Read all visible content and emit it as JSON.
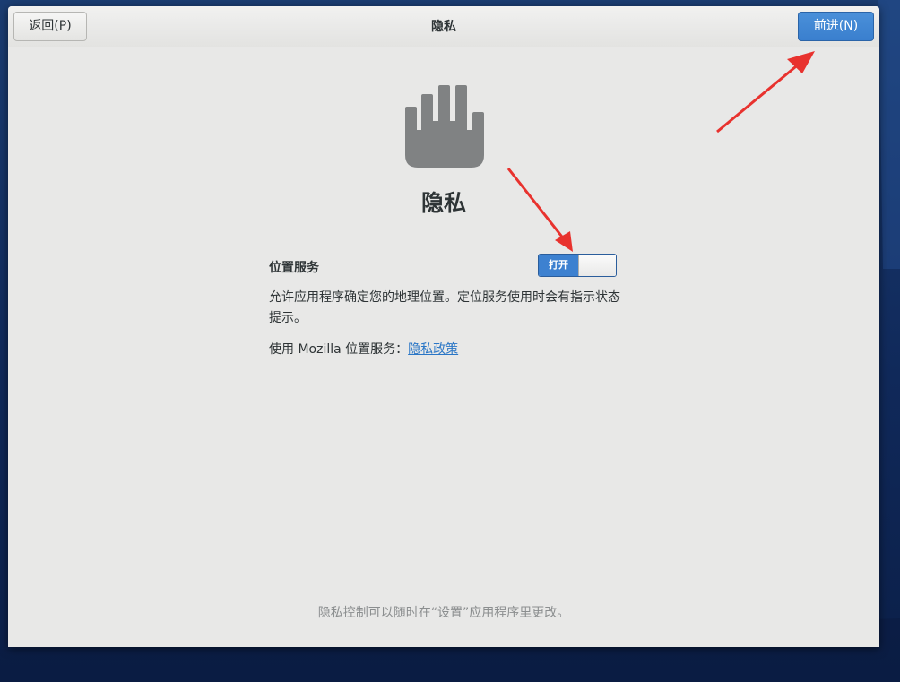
{
  "header": {
    "back_label": "返回(P)",
    "title": "隐私",
    "next_label": "前进(N)"
  },
  "page": {
    "icon": "hand-stop-icon",
    "heading": "隐私"
  },
  "location_services": {
    "label": "位置服务",
    "toggle_state_label": "打开",
    "toggle_on": true,
    "description": "允许应用程序确定您的地理位置。定位服务使用时会有指示状态提示。",
    "mozilla_prefix": "使用 Mozilla 位置服务：",
    "policy_link": "隐私政策"
  },
  "footer": {
    "note": "隐私控制可以随时在“设置”应用程序里更改。"
  },
  "colors": {
    "accent_blue": "#3d81d0",
    "link_blue": "#2a76c6",
    "annotation_red": "#e8322e",
    "icon_gray": "#808283"
  }
}
